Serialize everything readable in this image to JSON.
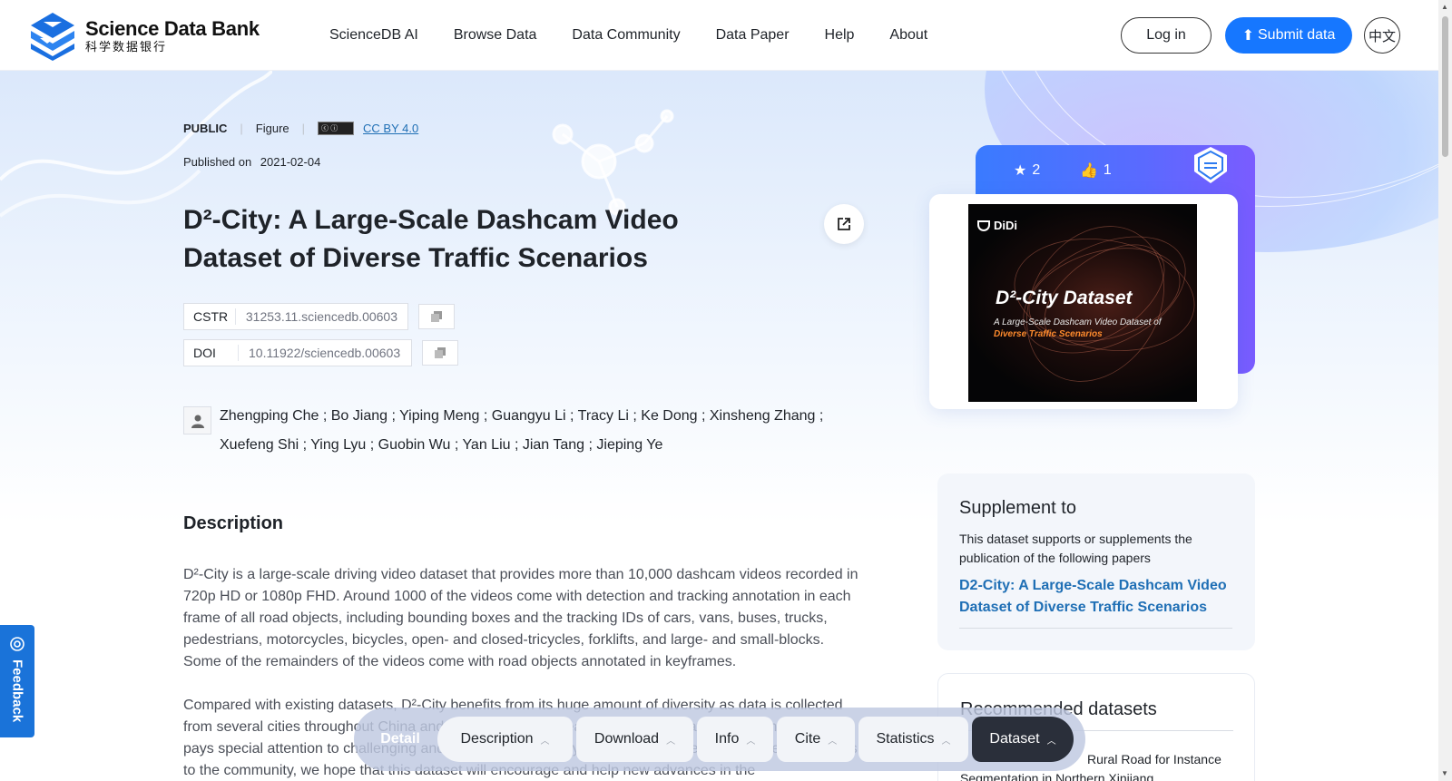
{
  "header": {
    "logo_title": "Science Data Bank",
    "logo_sub": "科学数据银行",
    "nav": [
      "ScienceDB AI",
      "Browse Data",
      "Data Community",
      "Data Paper",
      "Help",
      "About"
    ],
    "login": "Log in",
    "submit": "Submit data",
    "lang": "中文"
  },
  "meta": {
    "access": "PUBLIC",
    "type": "Figure",
    "license": "CC BY 4.0",
    "published_label": "Published on",
    "published_date": "2021-02-04"
  },
  "title_line1": "D²-City: A Large-Scale Dashcam Video",
  "title_line2": "Dataset of Diverse Traffic Scenarios",
  "ids": {
    "cstr_label": "CSTR",
    "cstr_value": "31253.11.sciencedb.00603",
    "doi_label": "DOI",
    "doi_value": "10.11922/sciencedb.00603"
  },
  "authors_line1": "Zhengping Che ; Bo Jiang ; Yiping Meng ; Guangyu Li ; Tracy Li ; Ke Dong ; Xinsheng Zhang ;",
  "authors_line2": "Xuefeng Shi ; Ying Lyu ; Guobin Wu ; Yan Liu ; Jian Tang ; Jieping Ye",
  "description": {
    "heading": "Description",
    "p1": "D²-City is a large-scale driving video dataset that provides more than 10,000 dashcam videos recorded in 720p HD or 1080p FHD. Around 1000 of the videos come with detection and tracking annotation in each frame of all road objects, including bounding boxes and the tracking IDs of cars, vans, buses, trucks, pedestrians, motorcycles, bicycles, open- and closed-tricycles, forklifts, and large- and small-blocks. Some of the remainders of the videos come with road objects annotated in keyframes.",
    "p2": "Compared with existing datasets, D²-City benefits from its huge amount of diversity as data is collected from several cities throughout China and features varying weather, road, and traffic conditions. D²-City pays special attention to challenging and actual case data. By bringing a diverse set of challenging cases to the community, we hope that this dataset will encourage and help new advances in the"
  },
  "stats": {
    "stars": "2",
    "likes": "1"
  },
  "cover": {
    "brand": "DiDi",
    "title": "D²-City Dataset",
    "sub1": "A Large-Scale Dashcam Video Dataset of",
    "sub2": "Diverse Traffic Scenarios"
  },
  "supplement": {
    "title": "Supplement to",
    "text": "This dataset supports or supplements the publication of the following papers",
    "link": "D2-City: A Large-Scale Dashcam Video Dataset of Diverse Traffic Scenarios"
  },
  "recommended": {
    "title": "Recommended datasets",
    "item": "Rural Road for Instance Segmentation in Northern Xinjiang"
  },
  "feedback": "Feedback",
  "tabbar": {
    "detail": "Detail",
    "tabs": [
      "Description",
      "Download",
      "Info",
      "Cite",
      "Statistics",
      "Dataset"
    ]
  },
  "colors": {
    "primary": "#1677ff",
    "link": "#1f6fb5",
    "feedback": "#1a73d9"
  }
}
